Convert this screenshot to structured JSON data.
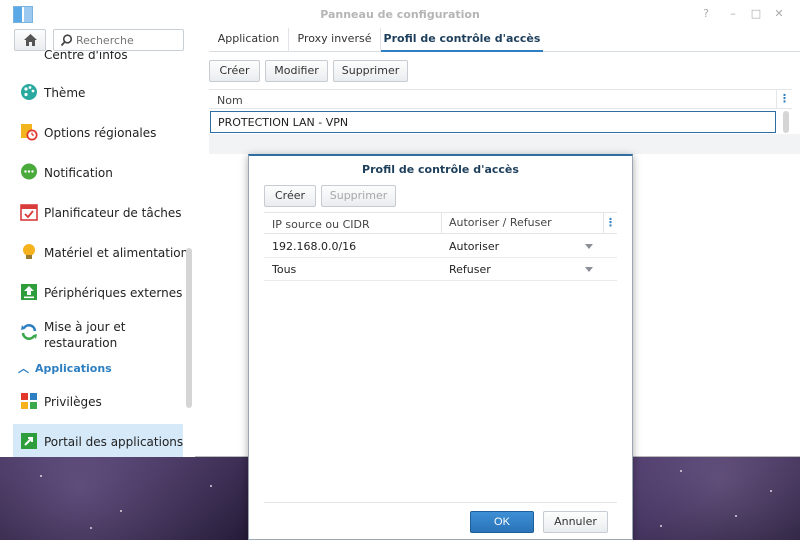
{
  "window": {
    "title": "Panneau de configuration",
    "controls": [
      "?",
      "–",
      "□",
      "✕"
    ]
  },
  "sidebar": {
    "search_placeholder": "Recherche",
    "items": [
      {
        "label": "Centre d'infos",
        "icon": "info-icon"
      },
      {
        "label": "Thème",
        "icon": "palette-icon"
      },
      {
        "label": "Options régionales",
        "icon": "regional-clock-icon"
      },
      {
        "label": "Notification",
        "icon": "chat-bubble-icon"
      },
      {
        "label": "Planificateur de tâches",
        "icon": "calendar-check-icon"
      },
      {
        "label": "Matériel et alimentation",
        "icon": "lightbulb-icon"
      },
      {
        "label": "Périphériques externes",
        "icon": "upload-arrow-icon"
      },
      {
        "label": "Mise à jour et restauration",
        "icon": "refresh-icon"
      }
    ],
    "section": "Applications",
    "section_items": [
      {
        "label": "Privilèges",
        "icon": "grid-apps-icon"
      },
      {
        "label": "Portail des applications",
        "icon": "portal-arrow-icon",
        "active": true
      }
    ]
  },
  "content": {
    "tabs": [
      "Application",
      "Proxy inversé",
      "Profil de contrôle d'accès"
    ],
    "active_tab": 2,
    "toolbar": {
      "create": "Créer",
      "modify": "Modifier",
      "delete": "Supprimer"
    },
    "grid": {
      "header": "Nom",
      "rows": [
        "PROTECTION LAN - VPN"
      ]
    }
  },
  "dialog": {
    "title": "Profil de contrôle d'accès",
    "toolbar": {
      "create": "Créer",
      "delete": "Supprimer"
    },
    "columns": [
      "IP source ou CIDR",
      "Autoriser / Refuser"
    ],
    "rows": [
      {
        "ip": "192.168.0.0/16",
        "action": "Autoriser"
      },
      {
        "ip": "Tous",
        "action": "Refuser"
      }
    ],
    "ok": "OK",
    "cancel": "Annuler"
  },
  "colors": {
    "accent": "#2e7fc2",
    "active_item_bg": "#d6e9f8",
    "ok_button": "#2a73b8"
  }
}
